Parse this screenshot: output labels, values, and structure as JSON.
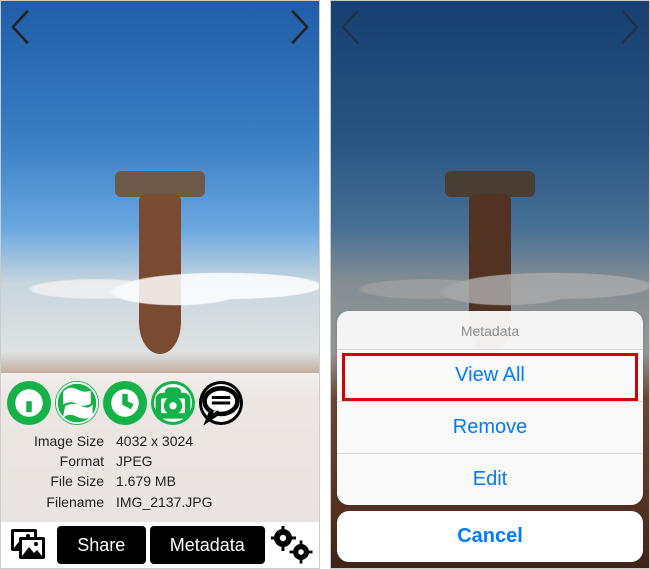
{
  "left": {
    "toolbar": {
      "share_label": "Share",
      "metadata_label": "Metadata"
    },
    "metadata": {
      "image_size_label": "Image Size",
      "image_size_value": "4032 x 3024",
      "format_label": "Format",
      "format_value": "JPEG",
      "file_size_label": "File Size",
      "file_size_value": "1.679 MB",
      "filename_label": "Filename",
      "filename_value": "IMG_2137.JPG"
    }
  },
  "right": {
    "sheet": {
      "title": "Metadata",
      "view_all": "View All",
      "remove": "Remove",
      "edit": "Edit",
      "cancel": "Cancel"
    }
  }
}
